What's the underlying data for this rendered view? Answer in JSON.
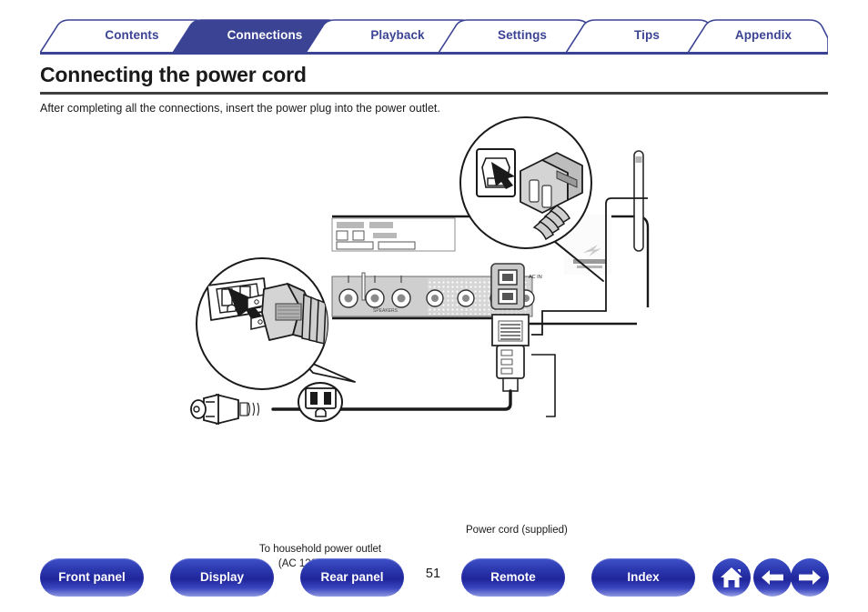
{
  "tabs": [
    {
      "label": "Contents",
      "active": false
    },
    {
      "label": "Connections",
      "active": true
    },
    {
      "label": "Playback",
      "active": false
    },
    {
      "label": "Settings",
      "active": false
    },
    {
      "label": "Tips",
      "active": false
    },
    {
      "label": "Appendix",
      "active": false
    }
  ],
  "header": {
    "title": "Connecting the power cord",
    "intro": "After completing all the connections, insert the power plug into the power outlet."
  },
  "figure": {
    "outlet_caption_line1": "To household power outlet",
    "outlet_caption_line2": "(AC 120 V, 60 Hz)",
    "cord_caption": "Power cord (supplied)",
    "ac_inlet_label": "AC IN",
    "callout_top_name": "iec-inlet-magnifier",
    "callout_bottom_name": "wall-outlet-magnifier"
  },
  "bottom_nav": {
    "buttons": [
      {
        "label": "Front panel"
      },
      {
        "label": "Display"
      },
      {
        "label": "Rear panel"
      },
      {
        "label": "Remote"
      },
      {
        "label": "Index"
      }
    ],
    "page_number": "51",
    "icons": [
      {
        "name": "home-icon"
      },
      {
        "name": "back-arrow-icon"
      },
      {
        "name": "forward-arrow-icon"
      }
    ]
  },
  "colors": {
    "accent_blue": "#3b4395",
    "tab_active_fill": "#3b4395",
    "rule_dark": "#3f3f3f",
    "button_blue": "#2b37ae"
  }
}
